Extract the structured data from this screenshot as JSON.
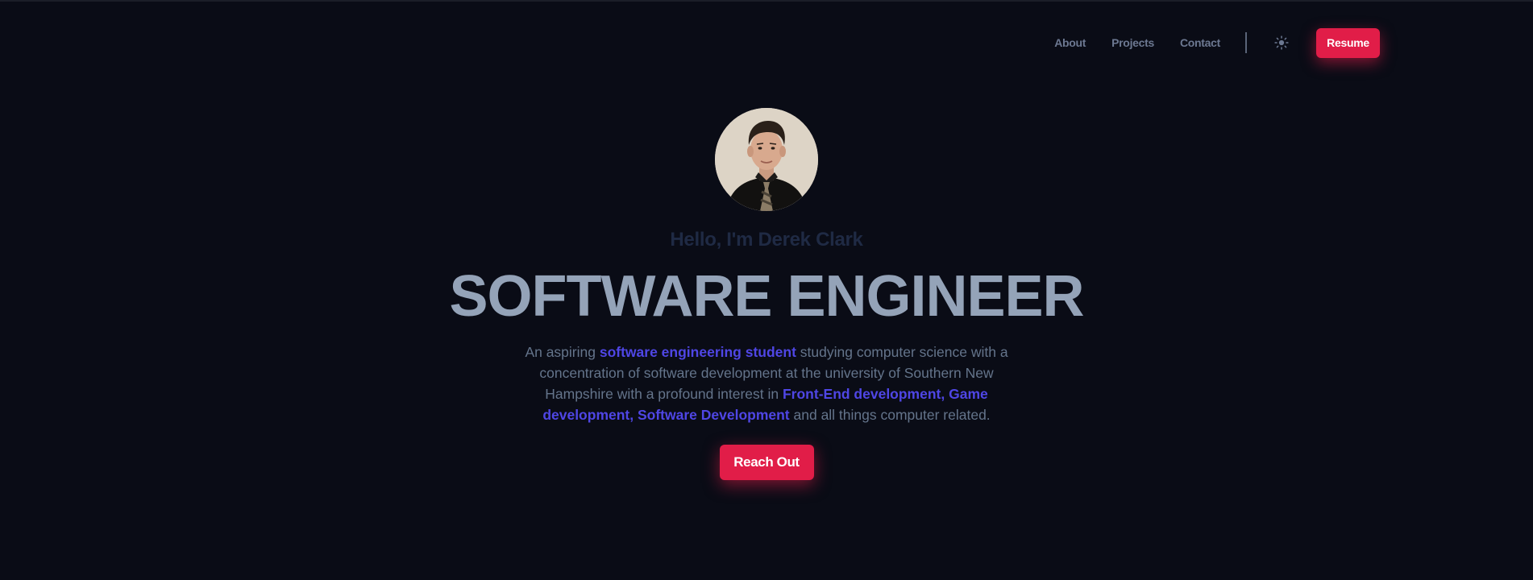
{
  "nav": {
    "links": [
      "About",
      "Projects",
      "Contact"
    ],
    "theme_toggle_icon": "sun-icon",
    "resume_label": "Resume"
  },
  "hero": {
    "avatar_alt": "profile-photo",
    "greeting": "Hello, I'm Derek Clark",
    "title": "SOFTWARE ENGINEER",
    "description": {
      "part1": "An aspiring ",
      "highlight1": "software engineering student",
      "part2": " studying computer science with a concentration of software development at the university of Southern New Hampshire with a profound interest in ",
      "highlight2": "Front-End development, Game development, Software Development",
      "part3": " and all things computer related."
    },
    "cta_label": "Reach Out"
  },
  "colors": {
    "background": "#0a0c16",
    "accent": "#e11d48",
    "highlight": "#4f46e5",
    "title": "#94a3b8",
    "muted": "#64748b"
  }
}
